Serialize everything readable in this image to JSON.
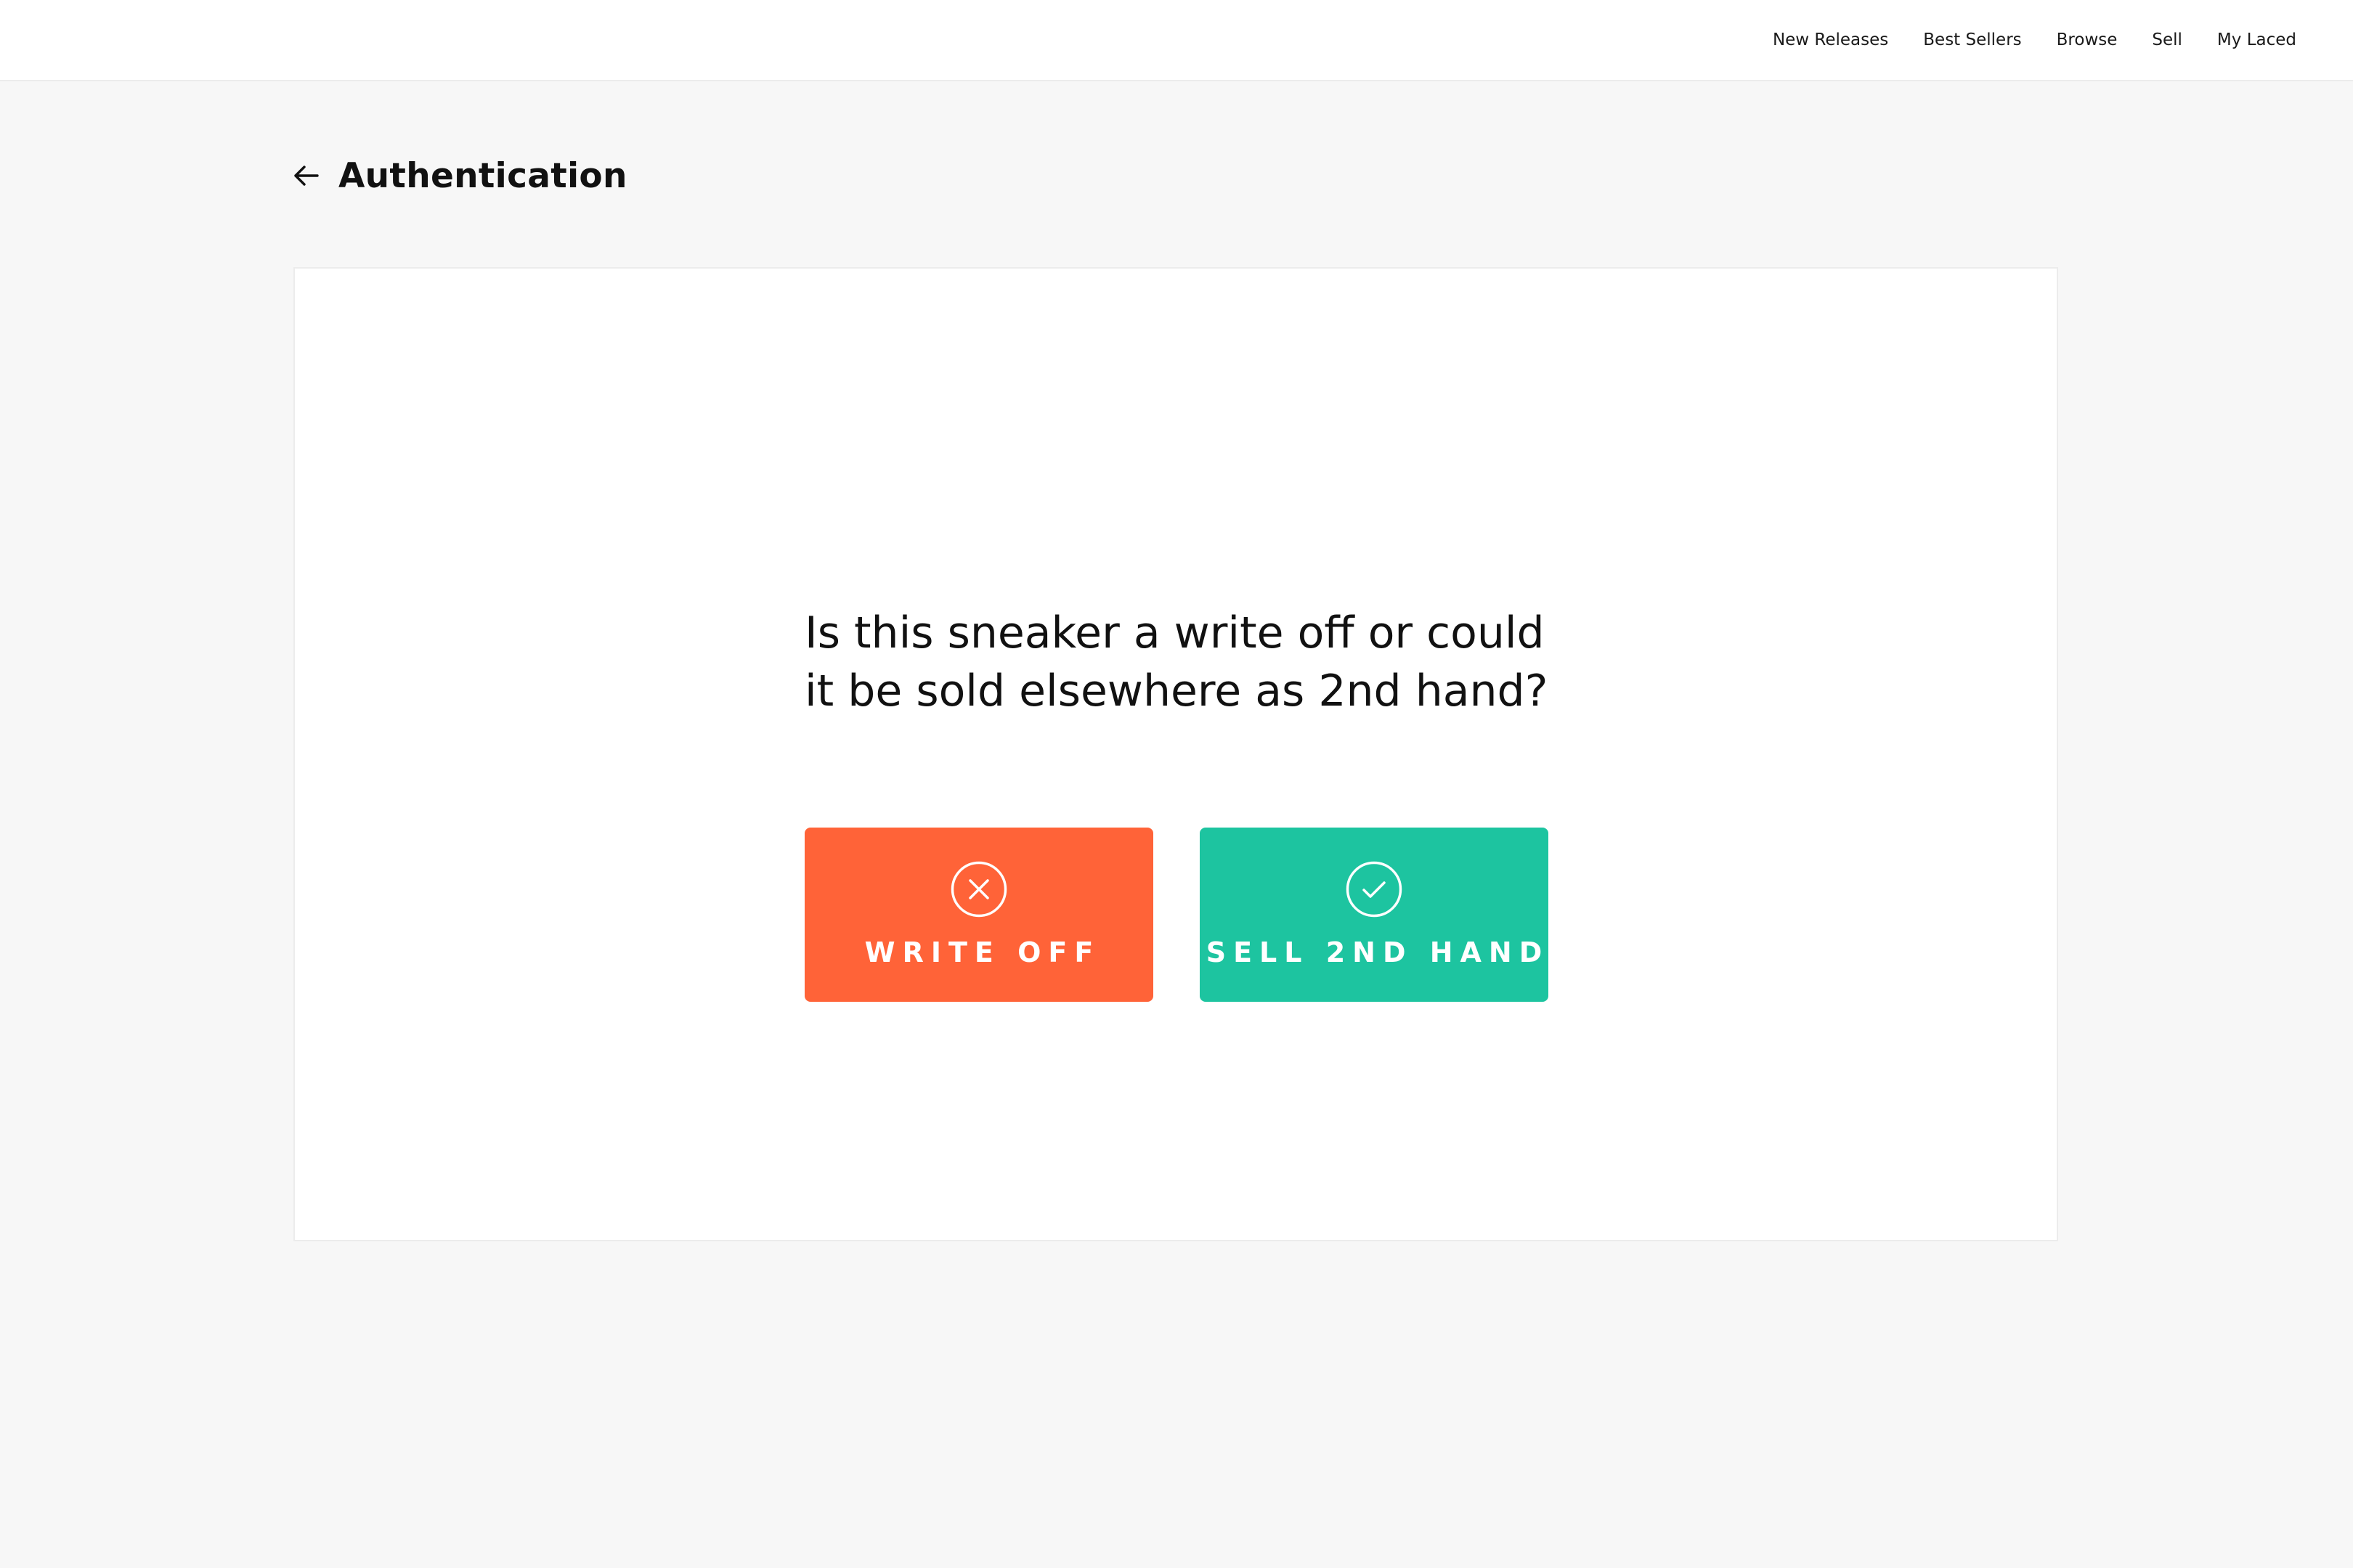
{
  "nav": {
    "items": [
      "New Releases",
      "Best Sellers",
      "Browse",
      "Sell",
      "My Laced"
    ]
  },
  "header": {
    "back_icon": "arrow-left-icon",
    "title": "Authentication"
  },
  "card": {
    "question": "Is this sneaker a write off or could it be sold elsewhere as 2nd hand?",
    "buttons": [
      {
        "label": "WRITE OFF",
        "icon": "circle-x-icon",
        "color": "#ff6338"
      },
      {
        "label": "SELL 2ND HAND",
        "icon": "circle-check-icon",
        "color": "#1dc4a0"
      }
    ]
  },
  "colors": {
    "page_background": "#f7f7f7",
    "surface": "#ffffff",
    "border": "#ececec",
    "text": "#111111",
    "write_off": "#ff6338",
    "sell_2nd_hand": "#1dc4a0"
  }
}
